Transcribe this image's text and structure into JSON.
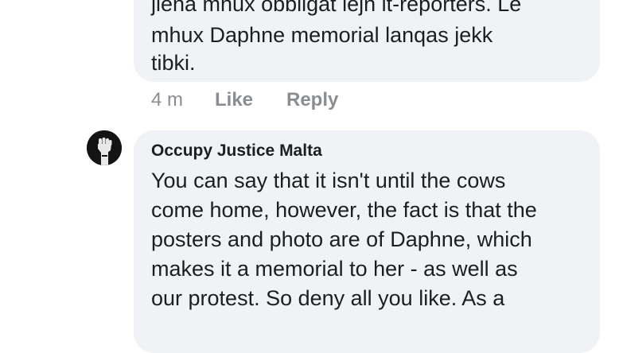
{
  "comment1": {
    "lines": [
      "jiena mhux obbligat lejn it-reporters. Le",
      "mhux Daphne memorial lanqas jekk",
      "tibki."
    ],
    "time": "4 m",
    "like_label": "Like",
    "reply_label": "Reply"
  },
  "comment2": {
    "author": "Occupy Justice Malta",
    "avatar_icon": "raised-fist-icon",
    "lines": [
      "You can say that it isn't until the cows",
      "come home, however, the fact is that the",
      "posters and photo are of Daphne, which",
      "makes it a memorial to her - as well as",
      "our protest.  So deny all you like.  As a"
    ]
  },
  "colors": {
    "bubble": "#f0f2f5",
    "text": "#1c1e21",
    "meta": "#8a8d91"
  }
}
